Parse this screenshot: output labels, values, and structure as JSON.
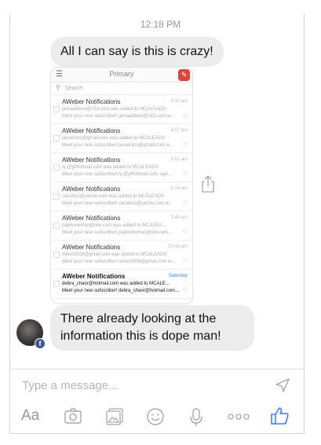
{
  "status_time": "12:18 PM",
  "messages": {
    "first": "All I can say is this is crazy!",
    "reply": "There already looking at the information this is dope man!"
  },
  "screenshot": {
    "title": "Primary",
    "search_placeholder": "Search",
    "emails": [
      {
        "sender": "AWeber Notifications",
        "time": "4:41 am",
        "line1": "jamaaldeen@163.com was added to MCALEADS",
        "line2": "Meet your new subscriber! jamaaldeen@163.com w..."
      },
      {
        "sender": "AWeber Notifications",
        "time": "4:07 pm",
        "line1": "lasverans@gmail.com was added to MCALEADS",
        "line2": "Meet your new subscriber! lasverans@gmail.com w..."
      },
      {
        "sender": "AWeber Notifications",
        "time": "3:51 am",
        "line1": "ty.@ytfhotmail.com was added to MCALEADS",
        "line2": "Meet your new subscriber! ty.@ytfhotmail.com sign..."
      },
      {
        "sender": "AWeber Notifications",
        "time": "6:19 am",
        "line1": "cacahu1@yahoo.com was added to MCALEADS",
        "line2": "Meet your new subscriber! cacahu1@yahoo.com w..."
      },
      {
        "sender": "AWeber Notifications",
        "time": "3:45 am",
        "line1": "paphoneman@live.com was added to MCALEA...",
        "line2": "Meet your new subscriber! paphoneman@live.com..."
      },
      {
        "sender": "AWeber Notifications",
        "time": "10:46 am",
        "line1": "mikerd306@gmail.com was added to MCALEADS",
        "line2": "Meet your new subscriber! mikerd306@gmail.com w..."
      },
      {
        "sender": "AWeber Notifications",
        "time": "Saturday",
        "line1": "debra_chaor@hotmail.com was added to MCALE...",
        "line2": "Meet your new subscriber! debra_chaor@hotmail.com..."
      }
    ]
  },
  "composer": {
    "placeholder": "Type a message...",
    "aa_label": "Aa",
    "more_label": "ooo"
  },
  "colors": {
    "accent": "#3b82f6",
    "bubble": "#ececec",
    "compose_red": "#e0423c"
  }
}
